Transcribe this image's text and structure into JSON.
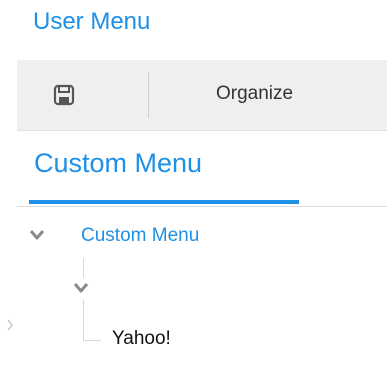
{
  "header": {
    "title": "User Menu"
  },
  "toolbar": {
    "save_icon": "save-icon",
    "organize_label": "Organize"
  },
  "tabs": [
    {
      "label": "Custom Menu",
      "active": true
    }
  ],
  "tree": {
    "root": {
      "label": "Custom Menu",
      "expanded": true
    },
    "child": {
      "label": "",
      "expanded": true
    },
    "leaf": {
      "label": "Yahoo!"
    }
  },
  "colors": {
    "accent": "#1e90e6",
    "toolbar_bg": "#efefef",
    "tree_line": "#d7d7d7",
    "chevron": "#8a8a8a"
  }
}
